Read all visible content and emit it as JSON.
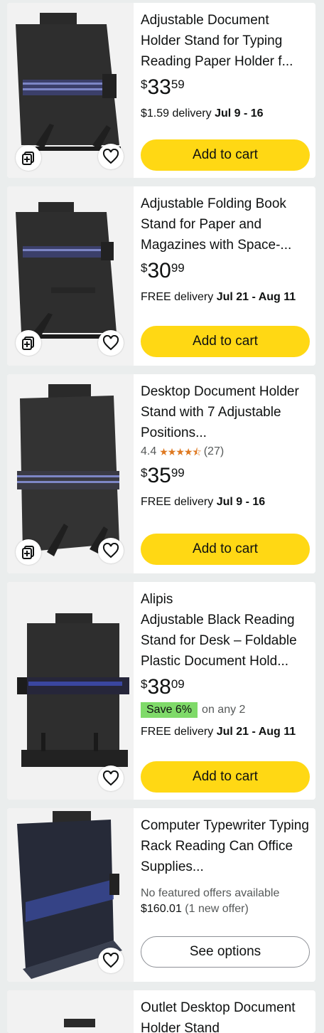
{
  "products": [
    {
      "title": "Adjustable Document Holder Stand for Typing Reading Paper Holder f...",
      "price": {
        "symbol": "$",
        "whole": "33",
        "fraction": "59"
      },
      "delivery_prefix": "$1.59 delivery ",
      "delivery_date": "Jul 9 - 16",
      "button": "Add to cart"
    },
    {
      "title": "Adjustable Folding Book Stand for Paper and Magazines with Space-...",
      "price": {
        "symbol": "$",
        "whole": "30",
        "fraction": "99"
      },
      "delivery_prefix": "FREE delivery ",
      "delivery_date": "Jul 21 - Aug 11",
      "button": "Add to cart"
    },
    {
      "title": "Desktop Document Holder Stand with 7 Adjustable Positions...",
      "rating": "4.4",
      "rating_stars": 4.4,
      "review_count": "(27)",
      "price": {
        "symbol": "$",
        "whole": "35",
        "fraction": "99"
      },
      "delivery_prefix": "FREE delivery ",
      "delivery_date": "Jul 9 - 16",
      "button": "Add to cart"
    },
    {
      "brand": "Alipis",
      "title": "Adjustable Black Reading Stand for Desk – Foldable Plastic Document Hold...",
      "price": {
        "symbol": "$",
        "whole": "38",
        "fraction": "09"
      },
      "save_badge": "Save 6%",
      "save_text": "on any 2",
      "delivery_prefix": "FREE delivery ",
      "delivery_date": "Jul 21 - Aug 11",
      "button": "Add to cart"
    },
    {
      "title": "Computer Typewriter Typing Rack Reading Can Office Supplies...",
      "no_offers": "No featured offers available",
      "offer_price": "$160.01",
      "offer_count": "(1 new offer)",
      "button": "See options"
    },
    {
      "title": "Outlet Desktop Document Holder Stand"
    }
  ],
  "icons": {
    "compare": "compare-icon",
    "wishlist": "heart-icon"
  },
  "colors": {
    "button_yellow": "#ffd814",
    "save_badge": "#7fda69",
    "star": "#de7921"
  }
}
